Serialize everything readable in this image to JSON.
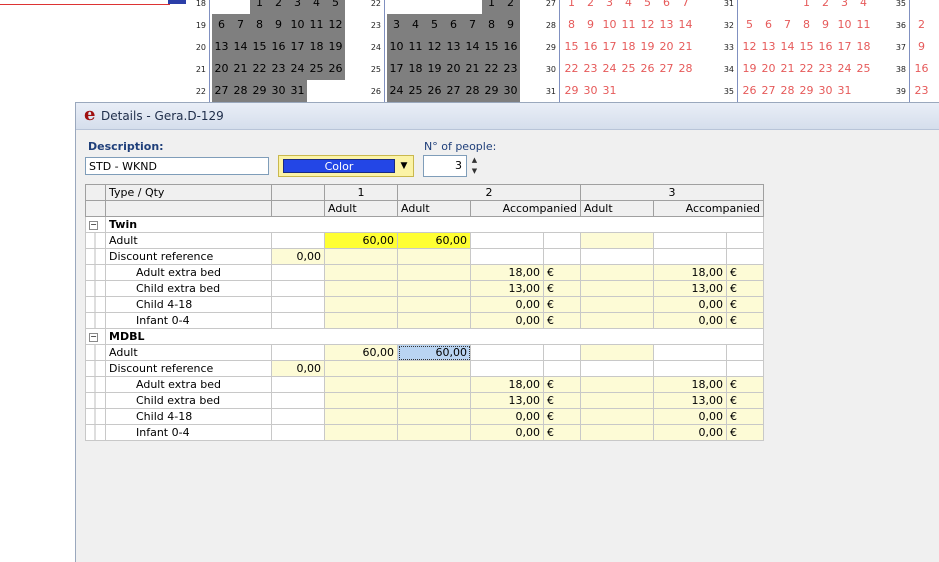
{
  "calendar": {
    "blocks": [
      {
        "weeks": [
          "18",
          "19",
          "20",
          "21",
          "22"
        ],
        "rows": [
          [
            "",
            "",
            "1",
            "2",
            "3",
            "4",
            "5"
          ],
          [
            "6",
            "7",
            "8",
            "9",
            "10",
            "11",
            "12"
          ],
          [
            "13",
            "14",
            "15",
            "16",
            "17",
            "18",
            "19"
          ],
          [
            "20",
            "21",
            "22",
            "23",
            "24",
            "25",
            "26"
          ],
          [
            "27",
            "28",
            "29",
            "30",
            "31",
            "",
            ""
          ]
        ],
        "style": "gray"
      },
      {
        "weeks": [
          "22",
          "23",
          "24",
          "25",
          "26"
        ],
        "rows": [
          [
            "",
            "",
            "",
            "",
            "",
            "1",
            "2"
          ],
          [
            "3",
            "4",
            "5",
            "6",
            "7",
            "8",
            "9"
          ],
          [
            "10",
            "11",
            "12",
            "13",
            "14",
            "15",
            "16"
          ],
          [
            "17",
            "18",
            "19",
            "20",
            "21",
            "22",
            "23"
          ],
          [
            "24",
            "25",
            "26",
            "27",
            "28",
            "29",
            "30"
          ]
        ],
        "style": "gray"
      },
      {
        "weeks": [
          "27",
          "28",
          "29",
          "30",
          "31"
        ],
        "rows": [
          [
            "1",
            "2",
            "3",
            "4",
            "5",
            "6",
            "7"
          ],
          [
            "8",
            "9",
            "10",
            "11",
            "12",
            "13",
            "14"
          ],
          [
            "15",
            "16",
            "17",
            "18",
            "19",
            "20",
            "21"
          ],
          [
            "22",
            "23",
            "24",
            "25",
            "26",
            "27",
            "28"
          ],
          [
            "29",
            "30",
            "31",
            "",
            "",
            "",
            ""
          ]
        ],
        "style": "pink"
      },
      {
        "weeks": [
          "31",
          "32",
          "33",
          "34",
          "35"
        ],
        "rows": [
          [
            "",
            "",
            "",
            "1",
            "2",
            "3",
            "4"
          ],
          [
            "5",
            "6",
            "7",
            "8",
            "9",
            "10",
            "11"
          ],
          [
            "12",
            "13",
            "14",
            "15",
            "16",
            "17",
            "18"
          ],
          [
            "19",
            "20",
            "21",
            "22",
            "23",
            "24",
            "25"
          ],
          [
            "26",
            "27",
            "28",
            "29",
            "30",
            "31",
            ""
          ]
        ],
        "style": "pink"
      },
      {
        "weeks": [
          "35",
          "36",
          "37",
          "38",
          "39"
        ],
        "rows": [
          [
            ""
          ],
          [
            "2"
          ],
          [
            "9"
          ],
          [
            "16"
          ],
          [
            "23"
          ]
        ],
        "style": "pink"
      }
    ]
  },
  "dialog": {
    "title": "Details - Gera.D-129",
    "description_label": "Description:",
    "description_value": "STD - WKND",
    "color_label": "Color",
    "people_label": "N° of people:",
    "people_value": "3",
    "swatch_color": "#2346e6"
  },
  "grid": {
    "header_type": "Type / Qty",
    "col_groups": [
      "1",
      "2",
      "3"
    ],
    "sub_headers": [
      "Adult",
      "Adult",
      "Accompanied",
      "Adult",
      "Accompanied"
    ],
    "groups": [
      {
        "name": "Twin",
        "rows": [
          {
            "label": "Adult",
            "base": "",
            "c1": "60,00",
            "c2": "60,00",
            "c3": "",
            "c3cur": "",
            "c4": "",
            "c5": "",
            "c5cur": ""
          },
          {
            "label": "Discount reference",
            "base": "0,00",
            "c1": "",
            "c2": "",
            "c3": "",
            "c3cur": "",
            "c4": "",
            "c5": "",
            "c5cur": ""
          },
          {
            "label": "Adult extra bed",
            "base": "",
            "c1": "",
            "c2": "",
            "c3": "18,00",
            "c3cur": "€",
            "c4": "",
            "c5": "18,00",
            "c5cur": "€"
          },
          {
            "label": "Child extra bed",
            "base": "",
            "c1": "",
            "c2": "",
            "c3": "13,00",
            "c3cur": "€",
            "c4": "",
            "c5": "13,00",
            "c5cur": "€"
          },
          {
            "label": "Child 4-18",
            "base": "",
            "c1": "",
            "c2": "",
            "c3": "0,00",
            "c3cur": "€",
            "c4": "",
            "c5": "0,00",
            "c5cur": "€"
          },
          {
            "label": "Infant 0-4",
            "base": "",
            "c1": "",
            "c2": "",
            "c3": "0,00",
            "c3cur": "€",
            "c4": "",
            "c5": "0,00",
            "c5cur": "€"
          }
        ]
      },
      {
        "name": "MDBL",
        "rows": [
          {
            "label": "Adult",
            "base": "",
            "c1": "60,00",
            "c2": "60,00",
            "c3": "",
            "c3cur": "",
            "c4": "",
            "c5": "",
            "c5cur": ""
          },
          {
            "label": "Discount reference",
            "base": "0,00",
            "c1": "",
            "c2": "",
            "c3": "",
            "c3cur": "",
            "c4": "",
            "c5": "",
            "c5cur": ""
          },
          {
            "label": "Adult extra bed",
            "base": "",
            "c1": "",
            "c2": "",
            "c3": "18,00",
            "c3cur": "€",
            "c4": "",
            "c5": "18,00",
            "c5cur": "€"
          },
          {
            "label": "Child extra bed",
            "base": "",
            "c1": "",
            "c2": "",
            "c3": "13,00",
            "c3cur": "€",
            "c4": "",
            "c5": "13,00",
            "c5cur": "€"
          },
          {
            "label": "Child 4-18",
            "base": "",
            "c1": "",
            "c2": "",
            "c3": "0,00",
            "c3cur": "€",
            "c4": "",
            "c5": "0,00",
            "c5cur": "€"
          },
          {
            "label": "Infant 0-4",
            "base": "",
            "c1": "",
            "c2": "",
            "c3": "0,00",
            "c3cur": "€",
            "c4": "",
            "c5": "0,00",
            "c5cur": "€"
          }
        ]
      }
    ]
  }
}
